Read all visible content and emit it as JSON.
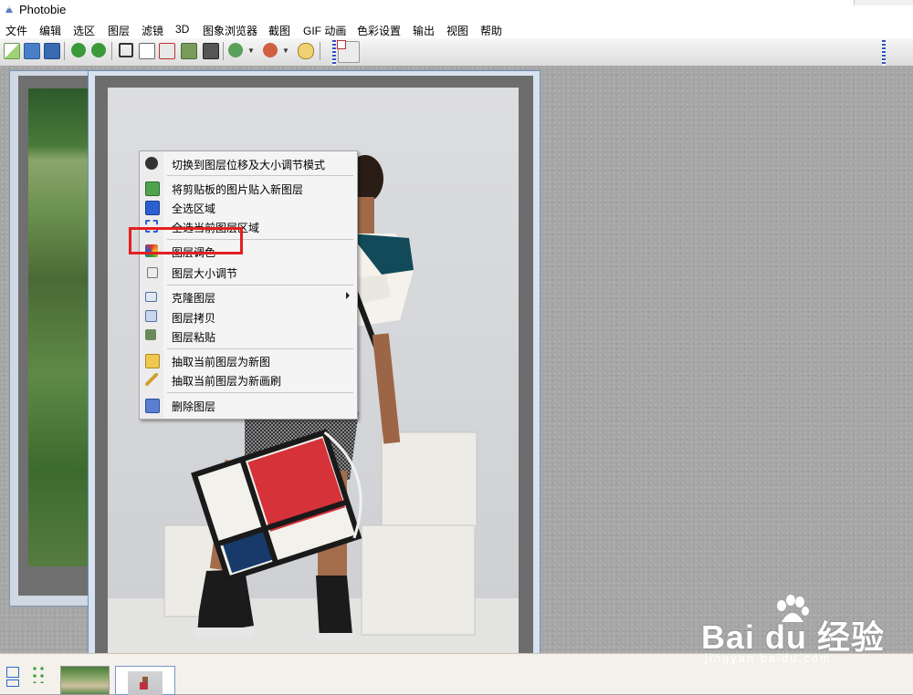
{
  "app": {
    "title": "Photobie"
  },
  "menu": [
    "文件",
    "编辑",
    "选区",
    "图层",
    "滤镜",
    "3D",
    "图象浏览器",
    "截图",
    "GIF 动画",
    "色彩设置",
    "输出",
    "视图",
    "帮助"
  ],
  "toolbar_icons": [
    "new-file-icon",
    "open-icon",
    "save-icon",
    "undo-icon",
    "redo-icon",
    "crop-icon",
    "copy-icon",
    "cut-icon",
    "paste-icon",
    "paste-new-icon",
    "zoom-in-icon",
    "zoom-out-icon",
    "zoom-fit-icon"
  ],
  "context_menu": {
    "items": [
      {
        "label": "切换到图层位移及大小调节模式",
        "icon": "move-resize-icon"
      },
      {
        "label": "将剪贴板的图片贴入新图层",
        "icon": "paste-layer-icon"
      },
      {
        "label": "全选区域",
        "icon": "select-all-icon"
      },
      {
        "label": "全选当前图层区域",
        "icon": "select-layer-icon"
      },
      {
        "label": "图层调色",
        "icon": "color-adjust-icon"
      },
      {
        "label": "图层大小调节",
        "icon": "resize-icon"
      },
      {
        "label": "克隆图层",
        "icon": "clone-icon",
        "submenu": true
      },
      {
        "label": "图层拷贝",
        "icon": "layer-copy-icon"
      },
      {
        "label": "图层粘贴",
        "icon": "layer-paste-icon"
      },
      {
        "label": "抽取当前图层为新图",
        "icon": "extract-image-icon"
      },
      {
        "label": "抽取当前图层为新画刷",
        "icon": "extract-brush-icon"
      },
      {
        "label": "删除图层",
        "icon": "delete-layer-icon"
      }
    ],
    "highlighted": "图层调色"
  },
  "watermark": {
    "text": "Bai du 经验",
    "sub": "jingyan.baidu.com"
  },
  "colors": {
    "highlight": "#e41f1f",
    "selection_blue": "#3050c0"
  }
}
